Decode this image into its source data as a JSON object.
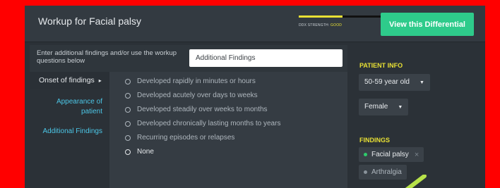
{
  "header": {
    "title": "Workup for Facial palsy",
    "strength_label": "DDX STRENGTH:",
    "strength_value": "GOOD",
    "strength_fraction": 0.72,
    "view_button": "View this Differential"
  },
  "workup": {
    "prompt": "Enter additional findings and/or use the workup questions below",
    "input_value": "Additional Findings",
    "nav": {
      "onset": "Onset of findings",
      "appearance": "Appearance of patient",
      "additional": "Additional Findings"
    },
    "options": [
      "Developed rapidly in minutes or hours",
      "Developed acutely over days to weeks",
      "Developed steadily over weeks to months",
      "Developed chronically lasting months to years",
      "Recurring episodes or relapses",
      "None"
    ]
  },
  "patient_info": {
    "heading": "PATIENT INFO",
    "age": "50-59 year old",
    "sex": "Female"
  },
  "findings": {
    "heading": "FINDINGS",
    "items": [
      {
        "label": "Facial palsy",
        "dot_color": "#2ecb6b",
        "removable": true
      },
      {
        "label": "Arthralgia",
        "dot_color": "#8a939b",
        "removable": false
      }
    ]
  },
  "colors": {
    "accent_green": "#2ecb8b",
    "heading_yellow": "#e8e034",
    "link_blue": "#4cc6e6",
    "background_red": "#ff0000"
  }
}
